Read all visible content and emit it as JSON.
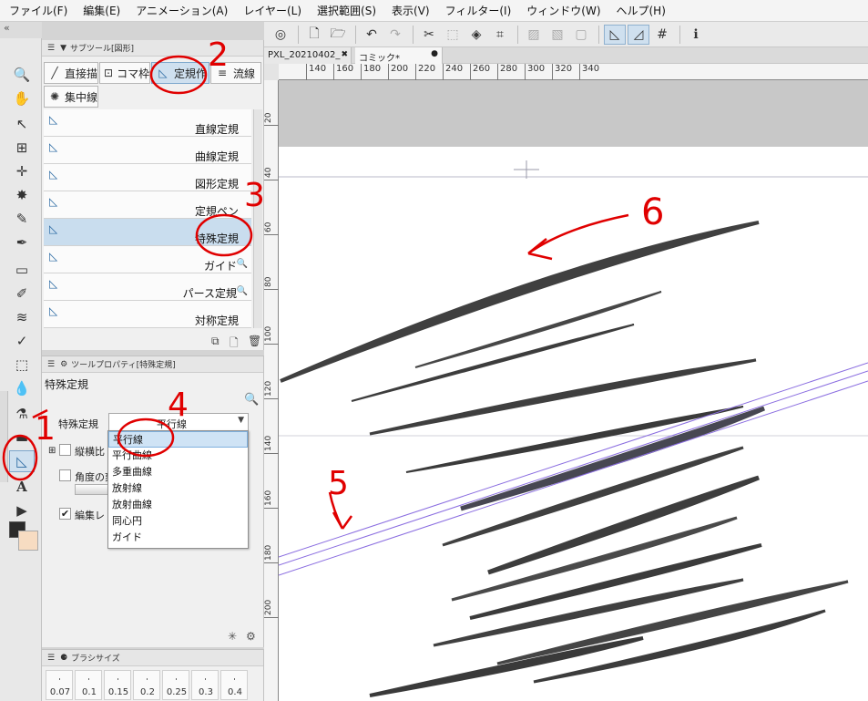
{
  "menu": [
    "ファイル(F)",
    "編集(E)",
    "アニメーション(A)",
    "レイヤー(L)",
    "選択範囲(S)",
    "表示(V)",
    "フィルター(I)",
    "ウィンドウ(W)",
    "ヘルプ(H)"
  ],
  "doc_tabs": [
    {
      "label": "PXL_20210402_",
      "close": "✖"
    },
    {
      "label": "コミック*",
      "close": "●"
    }
  ],
  "subtool": {
    "header": "サブツール[図形]",
    "tabs": [
      "直接描",
      "コマ枠",
      "定規作",
      "流線",
      "集中線"
    ],
    "items": [
      "直線定規",
      "曲線定規",
      "図形定規",
      "定規ペン",
      "特殊定規",
      "ガイド",
      "パース定規",
      "対称定規"
    ]
  },
  "toolprop": {
    "header": "ツールプロパティ[特殊定規]",
    "title": "特殊定規",
    "ruler_label": "特殊定規",
    "ruler_value": "平行線",
    "option1": "縦横比",
    "option2": "角度の刻",
    "option3": "編集レ"
  },
  "dropdown": {
    "options": [
      "平行線",
      "平行曲線",
      "多重曲線",
      "放射線",
      "放射曲線",
      "同心円",
      "ガイド"
    ],
    "selected": "平行線"
  },
  "brushsize": {
    "header": "ブラシサイズ",
    "sizes": [
      "0.07",
      "0.1",
      "0.15",
      "0.2",
      "0.25",
      "0.3",
      "0.4"
    ]
  },
  "ruler_h": [
    "140",
    "160",
    "180",
    "200",
    "220",
    "240",
    "260",
    "280",
    "300",
    "320",
    "340"
  ],
  "ruler_v": [
    "20",
    "40",
    "60",
    "80",
    "100",
    "120",
    "140",
    "160",
    "180",
    "200"
  ],
  "annotations": [
    "1",
    "2",
    "3",
    "4",
    "5",
    "6"
  ],
  "colors": {
    "accent": "#cfe0ef",
    "annotation": "#e00000",
    "ruler_line": "#8a6de0"
  }
}
